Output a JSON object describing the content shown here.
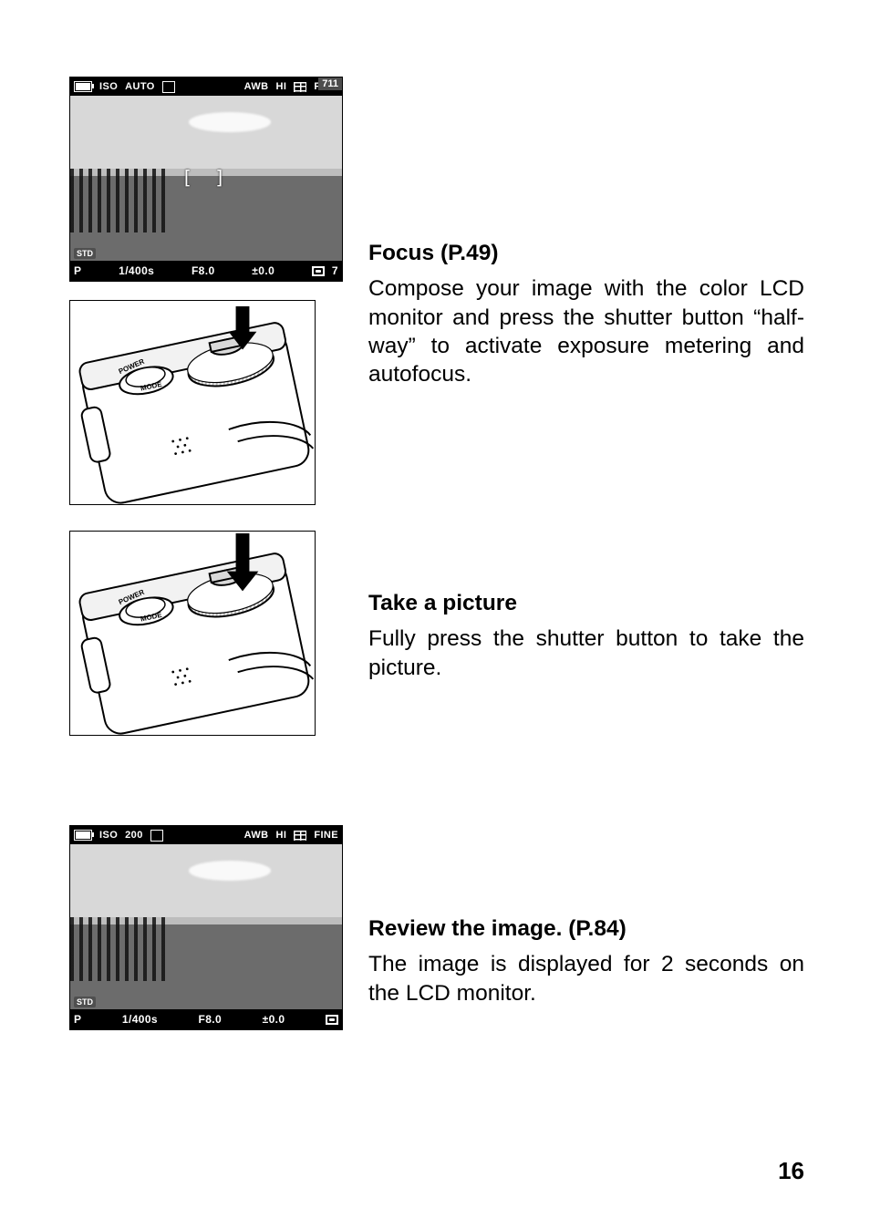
{
  "page_number": "16",
  "sections": {
    "focus": {
      "heading": "Focus (P.49)",
      "body": "Compose your image with the color LCD monitor and press the shutter button “half-way” to activate exposure metering and autofocus."
    },
    "take": {
      "heading": "Take a picture",
      "body": "Fully press the shutter button to take the picture."
    },
    "review": {
      "heading": "Review the image. (P.84)",
      "body": "The image is displayed for 2 seconds on the LCD monitor."
    }
  },
  "lcd_focus": {
    "top_left_iso_label": "ISO",
    "top_left_iso_value": "AUTO",
    "top_right_wb": "AWB",
    "top_right_res": "HI",
    "top_right_quality": "FINE",
    "shots_remaining": "711",
    "std": "STD",
    "center": "[   ]",
    "mode": "P",
    "shutter": "1/400s",
    "aperture": "F8.0",
    "ev": "±0.0",
    "af_remaining": "7"
  },
  "lcd_review": {
    "top_left_iso_label": "ISO",
    "top_left_iso_value": "200",
    "top_right_wb": "AWB",
    "top_right_res": "HI",
    "top_right_quality": "FINE",
    "std": "STD",
    "mode": "P",
    "shutter": "1/400s",
    "aperture": "F8.0",
    "ev": "±0.0"
  },
  "diagram_labels": {
    "power": "POWER",
    "mode": "MODE"
  }
}
